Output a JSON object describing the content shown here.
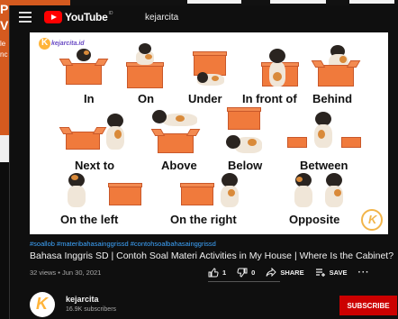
{
  "background": {
    "left_window_lines": [
      "Pc",
      "Vi",
      "le",
      "nc"
    ]
  },
  "header": {
    "logo_text": "YouTube",
    "logo_country": "ID",
    "search_query": "kejarcita"
  },
  "video": {
    "brand_logo_text": "kejarcita.id",
    "labels": {
      "in": "In",
      "on": "On",
      "under": "Under",
      "in_front_of": "In front of",
      "behind": "Behind",
      "next_to": "Next to",
      "above": "Above",
      "below": "Below",
      "between": "Between",
      "on_the_left": "On the left",
      "on_the_right": "On the right",
      "opposite": "Opposite"
    }
  },
  "info": {
    "hashtags": "#soallob #materibahasainggrissd #contohsoalbahasainggrissd",
    "title": "Bahasa Inggris SD | Contoh Soal Materi Activities in My House | Where Is the Cabinet?",
    "meta": "32 views • Jun 30, 2021",
    "likes": "1",
    "dislikes": "0",
    "share_label": "SHARE",
    "save_label": "SAVE",
    "more_label": "···"
  },
  "channel": {
    "name": "kejarcita",
    "subscribers": "16.9K subscribers",
    "subscribe_label": "SUBSCRIBE"
  },
  "colors": {
    "accent": "#cc0000",
    "box_orange": "#f07a3c",
    "link_blue": "#3ea6ff"
  }
}
